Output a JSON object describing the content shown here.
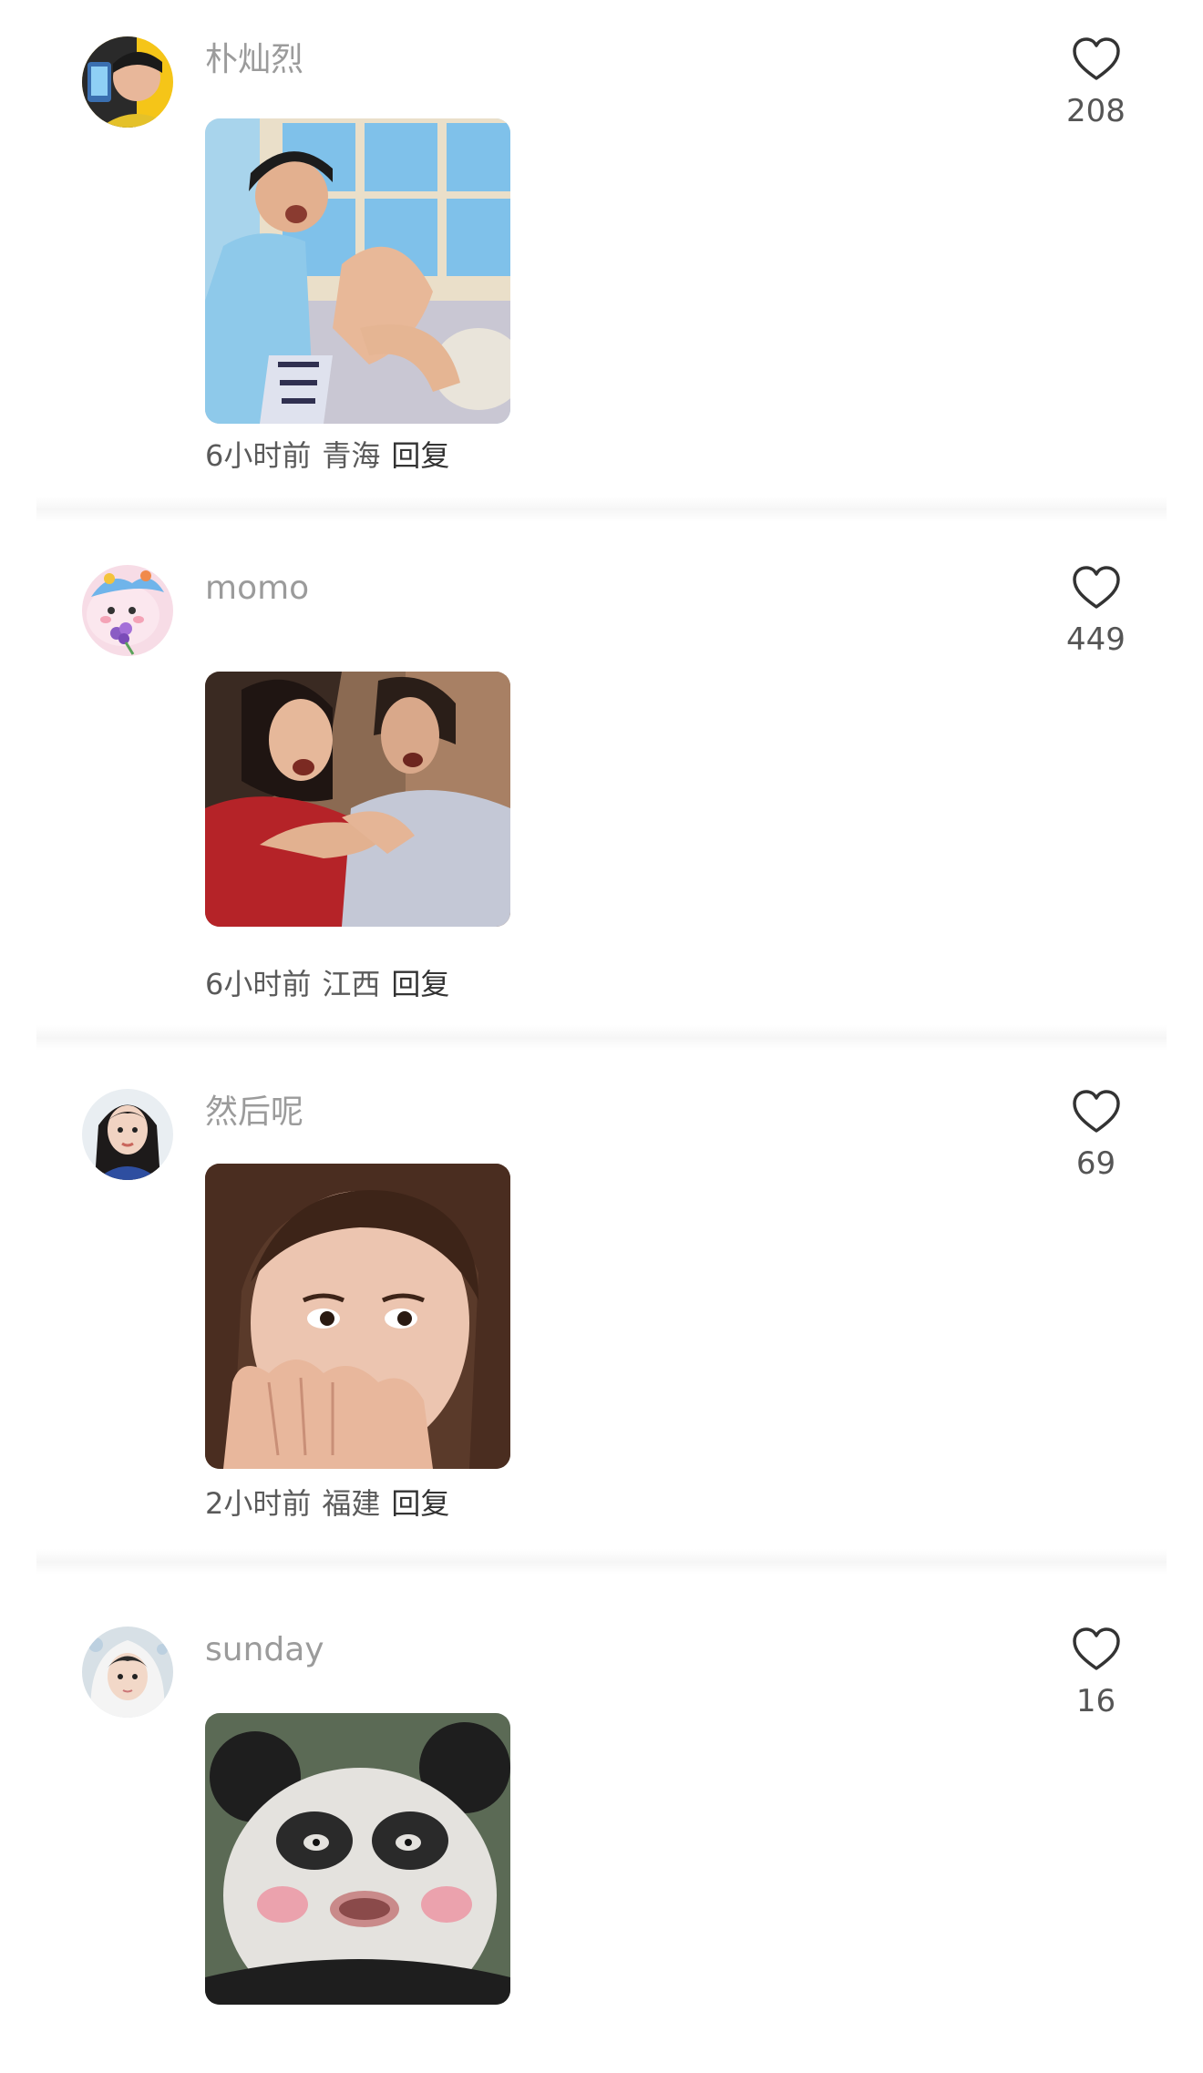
{
  "comments": [
    {
      "username": "朴灿烈",
      "time": "6小时前",
      "location": "青海",
      "reply_label": "回复",
      "likes": "208",
      "avatar_icon": "girl-holding-phone-avatar-icon",
      "media_icon": "crying-boy-meme-image"
    },
    {
      "username": "momo",
      "time": "6小时前",
      "location": "江西",
      "reply_label": "回复",
      "likes": "449",
      "avatar_icon": "cartoon-bunny-flowers-avatar-icon",
      "media_icon": "two-women-screaming-meme-image"
    },
    {
      "username": "然后呢",
      "time": "2小时前",
      "location": "福建",
      "reply_label": "回复",
      "likes": "69",
      "avatar_icon": "girl-portrait-avatar-icon",
      "media_icon": "woman-covering-mouth-meme-image"
    },
    {
      "username": "sunday",
      "likes": "16",
      "avatar_icon": "boy-in-hood-avatar-icon",
      "media_icon": "blushing-panda-meme-image"
    }
  ],
  "colors": {
    "username": "#9b9b9b",
    "meta": "#5a5a5a",
    "reply": "#333333",
    "like_count": "#555555"
  }
}
